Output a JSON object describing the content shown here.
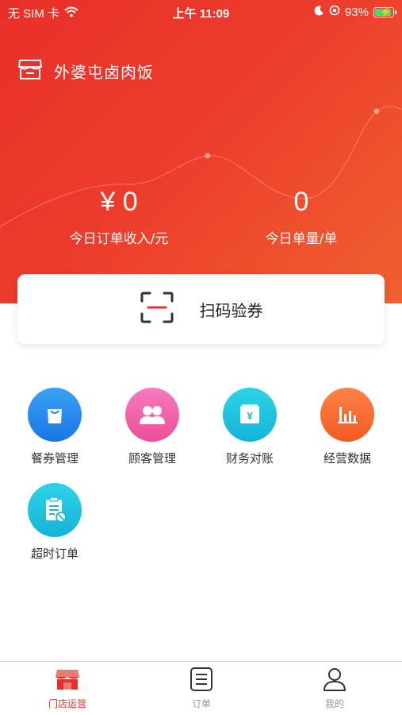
{
  "status_bar": {
    "carrier": "无 SIM 卡",
    "time": "上午 11:09",
    "battery": "93%"
  },
  "header": {
    "store_name": "外婆屯卤肉饭"
  },
  "stats": {
    "income_value": "¥ 0",
    "income_label": "今日订单收入/元",
    "count_value": "0",
    "count_label": "今日单量/单"
  },
  "scan": {
    "label": "扫码验券"
  },
  "grid": {
    "coupon_label": "餐券管理",
    "customer_label": "顾客管理",
    "finance_label": "财务对账",
    "data_label": "经营数据",
    "timeout_label": "超时订单"
  },
  "tabbar": {
    "store_label": "门店运营",
    "orders_label": "订单",
    "mine_label": "我的"
  },
  "colors": {
    "brand": "#e8302a",
    "tab_active": "#e8302a",
    "tab_inactive": "#999999"
  }
}
